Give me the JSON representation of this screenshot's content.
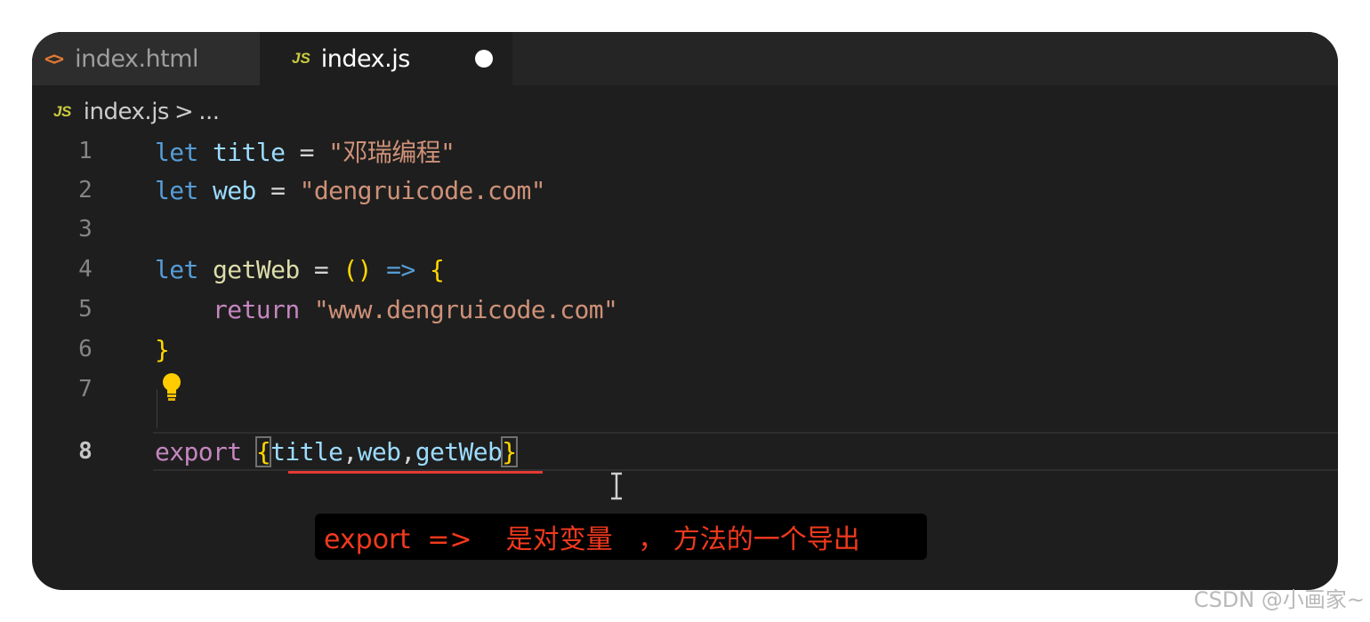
{
  "tabs": [
    {
      "icon": "html-file-icon",
      "glyph": "<>",
      "label": "index.html",
      "active": false
    },
    {
      "icon": "js-file-icon",
      "glyph": "JS",
      "label": "index.js",
      "active": true,
      "unsaved": true
    }
  ],
  "breadcrumb": {
    "glyph": "JS",
    "file": "index.js",
    "separator": ">",
    "more": "..."
  },
  "gutter": {
    "line_numbers": [
      "1",
      "2",
      "3",
      "4",
      "5",
      "6",
      "7",
      "8"
    ],
    "active_line": "8"
  },
  "code": {
    "l1": {
      "kw": "let",
      "var": "title",
      "op": "=",
      "str": "\"邓瑞编程\""
    },
    "l2": {
      "kw": "let",
      "var": "web",
      "op": "=",
      "str": "\"dengruicode.com\""
    },
    "l4": {
      "kw": "let",
      "fn": "getWeb",
      "op": "=",
      "parens": "()",
      "arrow": "=>",
      "brace": "{"
    },
    "l5": {
      "kw": "return",
      "str": "\"www.dengruicode.com\""
    },
    "l6": {
      "brace": "}"
    },
    "l8": {
      "kw": "export",
      "open": "{",
      "v1": "title",
      "comma1": ",",
      "v2": "web",
      "comma2": ",",
      "v3": "getWeb",
      "close": "}"
    }
  },
  "subtitle": "export  =>    是对变量   ， 方法的一个导出",
  "watermark": "CSDN @小画家~",
  "colors": {
    "keyword": "#569cd6",
    "variable": "#9cdcfe",
    "string": "#ce9178",
    "function": "#dcdcaa",
    "control": "#c586c0",
    "bracket": "#ffd700",
    "subtitle_text": "#f1391d",
    "underline": "#e53935"
  }
}
